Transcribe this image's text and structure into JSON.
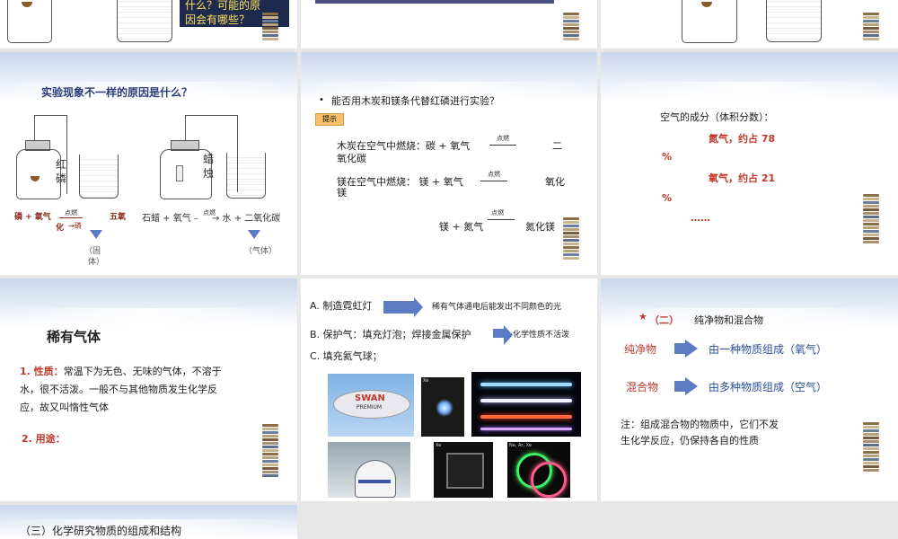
{
  "slide1": {
    "caption_line1": "什么？可能的原",
    "caption_line2": "因会有哪些？"
  },
  "slide4": {
    "title": "实验现象不一样的原因是什么？",
    "label_red": "红",
    "label_phos": "磷",
    "label_la": "蜡",
    "label_zhu": "烛",
    "eq_left": "磷 + 氧气",
    "eq_cond": "点燃",
    "eq_mid": "化",
    "eq_right_sub": "→磷",
    "eq_right": "五氧",
    "eq2": "石蜡 + 氧气 –",
    "eq2_cond": "点燃",
    "eq2_right": "→ 水 + 二氧化碳",
    "note_solid1": "（固",
    "note_solid2": "体）",
    "note_gas": "（气体）"
  },
  "slide5": {
    "question": "能否用木炭和镁条代替红磷进行实验？",
    "hint": "提示",
    "line1_a": "木炭在空气中燃烧：碳 + 氧气",
    "line1_cond": "点燃",
    "line1_b": "二",
    "line1_c": "氧化碳",
    "line2_a": "镁在空气中燃烧：   镁 + 氧气",
    "line2_cond": "点燃",
    "line2_b": "氧化",
    "line2_c": "镁",
    "line3_a": "镁 + 氮气",
    "line3_cond": "点燃",
    "line3_b": "氮化镁"
  },
  "slide6": {
    "title": "空气的成分（体积分数）：",
    "n2": "氮气，约占 78",
    "pct1": "%",
    "o2": "氧气，约占 21",
    "pct2": "%",
    "more": "……"
  },
  "slide7": {
    "title": "稀有气体",
    "prop_label": "1. 性质：",
    "prop_text1": "常温下为无色、无味的气体，不溶于",
    "prop_text2": "水，很不活泼。一般不与其他物质发生化学反",
    "prop_text3": "应，故又叫惰性气体",
    "use_label": "2. 用途："
  },
  "slide8": {
    "a": "A. 制造霓虹灯",
    "a_desc": "稀有气体通电后能发出不同颜色的光",
    "b": "B. 保护气：填充灯泡；焊接金属保护",
    "b_desc": "化学性质不活泼",
    "c": "C. 填充氦气球；",
    "blimp_text": "SWAN",
    "blimp_sub": "PREMIUM",
    "photo_label1": "Xe",
    "photo_label2": "Ne, Ar, Xe"
  },
  "slide9": {
    "star": "★",
    "heading_num": "（二）",
    "heading": "纯净物和混合物",
    "pure": "纯净物",
    "pure_desc": "由一种物质组成（氧气）",
    "mix": "混合物",
    "mix_desc": "由多种物质组成（空气）",
    "note1": "注：组成混合物的物质中，它们不发",
    "note2": "生化学反应，仍保持各自的性质"
  },
  "slide10": {
    "title": "（三）化学研究物质的组成和结构"
  },
  "colors": {
    "accent_red": "#c0392b",
    "arrow_blue": "#5b7cc4",
    "hint_bg": "#f5c26b",
    "dark_box": "#1d2a4d"
  }
}
